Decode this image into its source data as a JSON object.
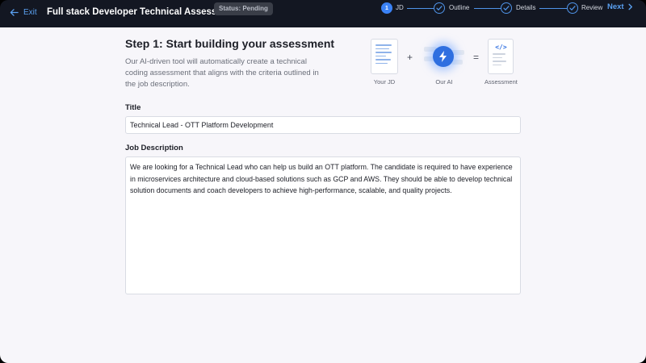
{
  "header": {
    "exit_label": "Exit",
    "title": "Full stack Developer Technical Assessment",
    "status": "Status: Pending",
    "next_label": "Next"
  },
  "stepper": {
    "steps": [
      {
        "number": "1",
        "label": "JD",
        "state": "current"
      },
      {
        "label": "Outline",
        "state": "pending"
      },
      {
        "label": "Details",
        "state": "pending"
      },
      {
        "label": "Review",
        "state": "pending"
      }
    ]
  },
  "main": {
    "heading": "Step 1: Start building your assessment",
    "intro": "Our AI-driven tool will automatically create a technical coding assessment that aligns with the criteria outlined in the job description.",
    "illustration": {
      "jd_caption": "Your JD",
      "plus": "+",
      "ai_caption": "Our AI",
      "equals": "=",
      "assessment_caption": "Assessment",
      "code_tag": "</>"
    },
    "title_label": "Title",
    "title_value": "Technical Lead - OTT Platform Development",
    "description_label": "Job Description",
    "description_value": "We are looking for a Technical Lead who can help us build an OTT platform. The candidate is required to have experience in microservices architecture and cloud-based solutions such as GCP and AWS. They should be able to develop technical solution documents and coach developers to achieve high-performance, scalable, and quality projects."
  },
  "colors": {
    "topbar": "#131722",
    "accent": "#3b82f6",
    "link": "#5aa0f0",
    "page_bg": "#f7f6fa"
  }
}
